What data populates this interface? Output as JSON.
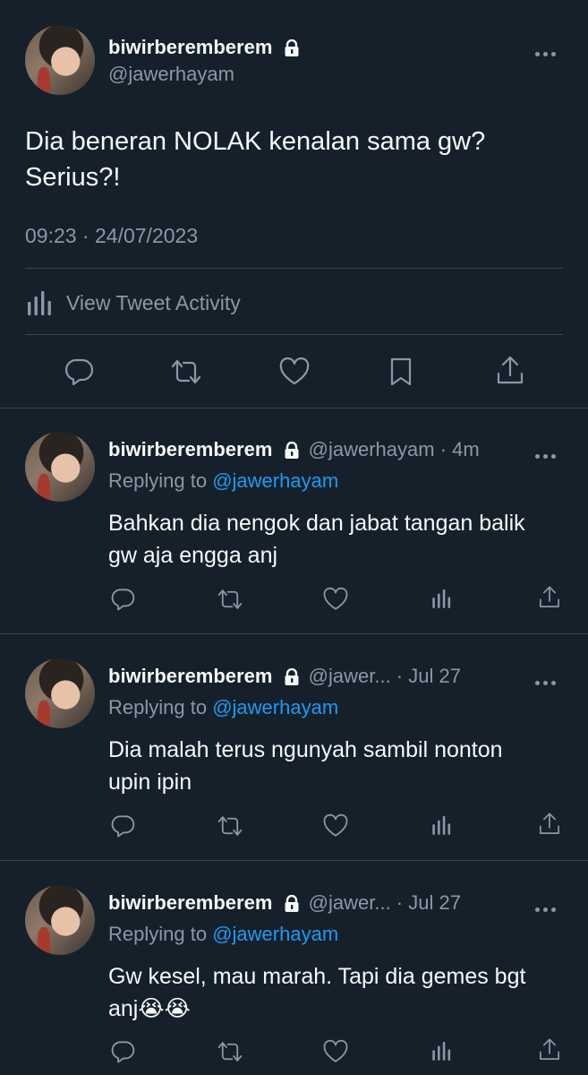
{
  "main_tweet": {
    "display_name": "biwirberemberem",
    "handle": "@jawerhayam",
    "text_line1": "Dia beneran NOLAK kenalan sama gw?",
    "text_line2": "Serius?!",
    "timestamp": "09:23 · 24/07/2023",
    "activity_label": "View Tweet Activity"
  },
  "replies": [
    {
      "display_name": "biwirberemberem",
      "handle_time": "@jawerhayam · 4m",
      "replying_prefix": "Replying to",
      "replying_to": "@jawerhayam",
      "line1": "Bahkan dia nengok dan jabat tangan balik",
      "line2": "gw aja engga anj"
    },
    {
      "display_name": "biwirberemberem",
      "handle_time": "@jawer... · Jul 27",
      "replying_prefix": "Replying to",
      "replying_to": "@jawerhayam",
      "line1": "Dia malah terus ngunyah sambil nonton",
      "line2": "upin ipin"
    },
    {
      "display_name": "biwirberemberem",
      "handle_time": "@jawer... · Jul 27",
      "replying_prefix": "Replying to",
      "replying_to": "@jawerhayam",
      "line1": "Gw kesel, mau marah. Tapi dia gemes bgt",
      "line2": "anj😭😭"
    }
  ],
  "colors": {
    "background": "#15202b",
    "text": "#f7f9f9",
    "muted": "#8b98a5",
    "link": "#1d9bf0",
    "divider": "#38444d"
  }
}
